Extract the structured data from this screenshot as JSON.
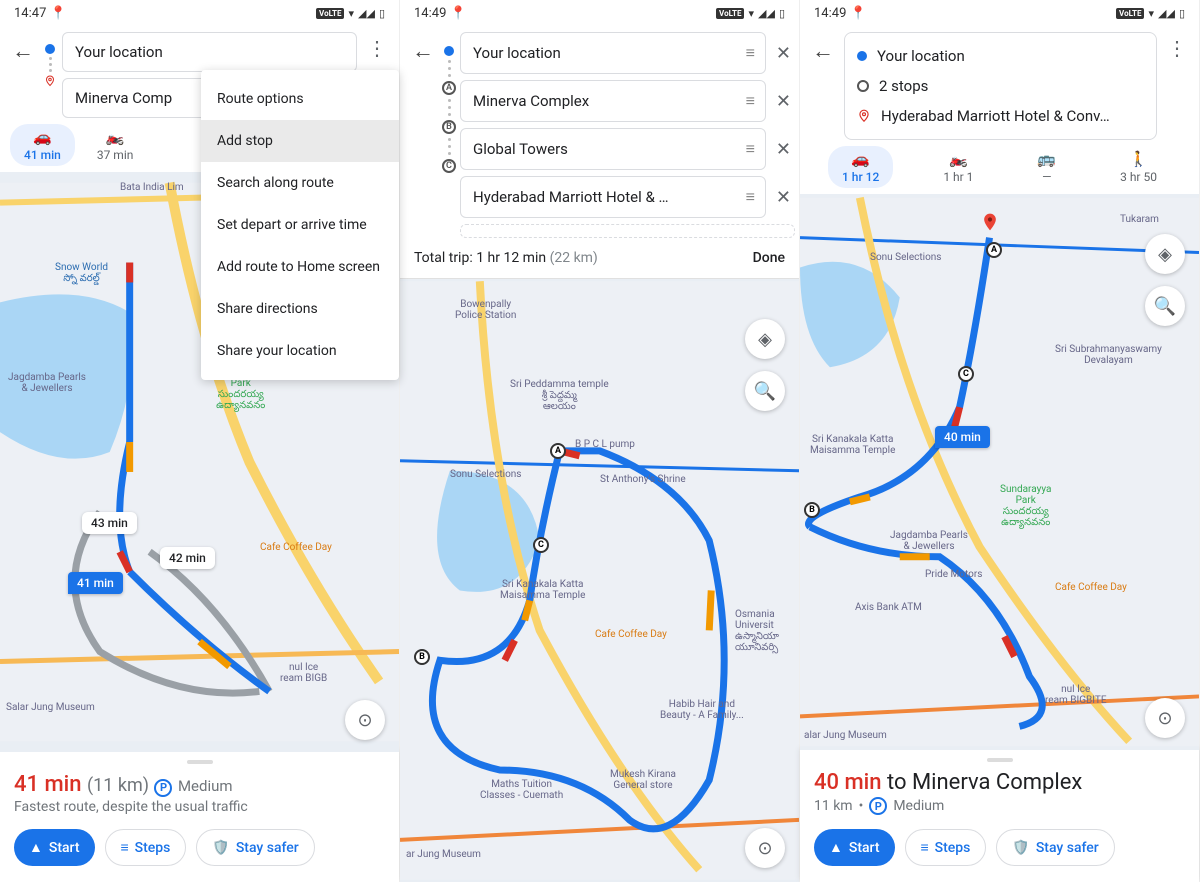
{
  "screen1": {
    "status_time": "14:47",
    "from": "Your location",
    "to": "Minerva Comp",
    "modes": [
      {
        "icon": "🚗",
        "time": "41 min",
        "active": true
      },
      {
        "icon": "🏍️",
        "time": "37 min",
        "active": false
      }
    ],
    "menu": [
      "Route options",
      "Add stop",
      "Search along route",
      "Set depart or arrive time",
      "Add route to Home screen",
      "Share directions",
      "Share your location"
    ],
    "map_labels": {
      "label43": "43 min",
      "label42": "42 min",
      "label41": "41 min",
      "poi_bata": "Bata India Lim",
      "poi_snow": "Snow World\nస్నో వరల్డ్",
      "poi_jagd": "Jagdamba Pearls\n& Jewellers",
      "poi_park": "Sundarayya\nPark\nసుందరయ్య\nఉద్యానవనం",
      "poi_cafe": "Cafe Coffee Day",
      "poi_salar": "Salar Jung Museum",
      "poi_ice": "nul Ice\nream BIGB"
    },
    "sheet": {
      "eta": "41 min",
      "dist": "(11 km)",
      "park": "Medium",
      "subtitle": "Fastest route, despite the usual traffic",
      "start": "Start",
      "steps": "Steps",
      "safer": "Stay safer"
    }
  },
  "screen2": {
    "status_time": "14:49",
    "from": "Your location",
    "stops": [
      "Minerva Complex",
      "Global Towers",
      "Hyderabad Marriott Hotel & …"
    ],
    "tripbar_prefix": "Total trip: ",
    "tripbar_time": "1 hr 12 min",
    "tripbar_dist": "(22 km)",
    "done": "Done",
    "map_pois": {
      "bowen": "Bowenpally\nPolice Station",
      "pedd": "Sri Peddamma temple\nశ్రీ పెద్దమ్మ\nఆలయం",
      "bpcl": "B P C L pump",
      "sonu": "Sonu Selections",
      "anth": "St Anthony's Shrine",
      "kana": "Sri Kanakala Katta\nMaisamma Temple",
      "cafe": "Cafe Coffee Day",
      "osm": "Osmania\nUniversit\nఉస్మానియా\nయూనివర్సి",
      "habib": "Habib Hair and\nBeauty - A Family...",
      "maths": "Maths Tuition\nClasses - Cuemath",
      "mukesh": "Mukesh Kirana\nGeneral store",
      "salar": "ar Jung Museum"
    }
  },
  "screen3": {
    "status_time": "14:49",
    "from": "Your location",
    "stops_summary": "2 stops",
    "dest": "Hyderabad Marriott Hotel & Conv…",
    "modes4": [
      {
        "icon": "🚗",
        "time": "1 hr 12",
        "active": true
      },
      {
        "icon": "🏍️",
        "time": "1 hr 1",
        "active": false
      },
      {
        "icon": "🚌",
        "time": "—",
        "active": false
      },
      {
        "icon": "🚶",
        "time": "3 hr 50",
        "active": false
      }
    ],
    "map_labels": {
      "label40": "40 min",
      "sonu": "Sonu Selections",
      "subr": "Sri Subrahmanyaswamy\nDevalayam",
      "kana": "Sri Kanakala Katta\nMaisamma Temple",
      "park": "Sundarayya\nPark\nసుందరయ్య\nఉద్యానవనం",
      "jagd": "Jagdamba Pearls\n& Jewellers",
      "pride": "Pride Motors",
      "axis": "Axis Bank ATM",
      "cafe": "Cafe Coffee Day",
      "salar": "alar Jung Museum",
      "ice": "nul Ice\nream BIGBITE",
      "tukar": "Tukaram"
    },
    "sheet": {
      "eta": "40 min",
      "to_line": "to Minerva Complex",
      "dist": "11 km",
      "park": "Medium",
      "start": "Start",
      "steps": "Steps",
      "safer": "Stay safer"
    }
  }
}
